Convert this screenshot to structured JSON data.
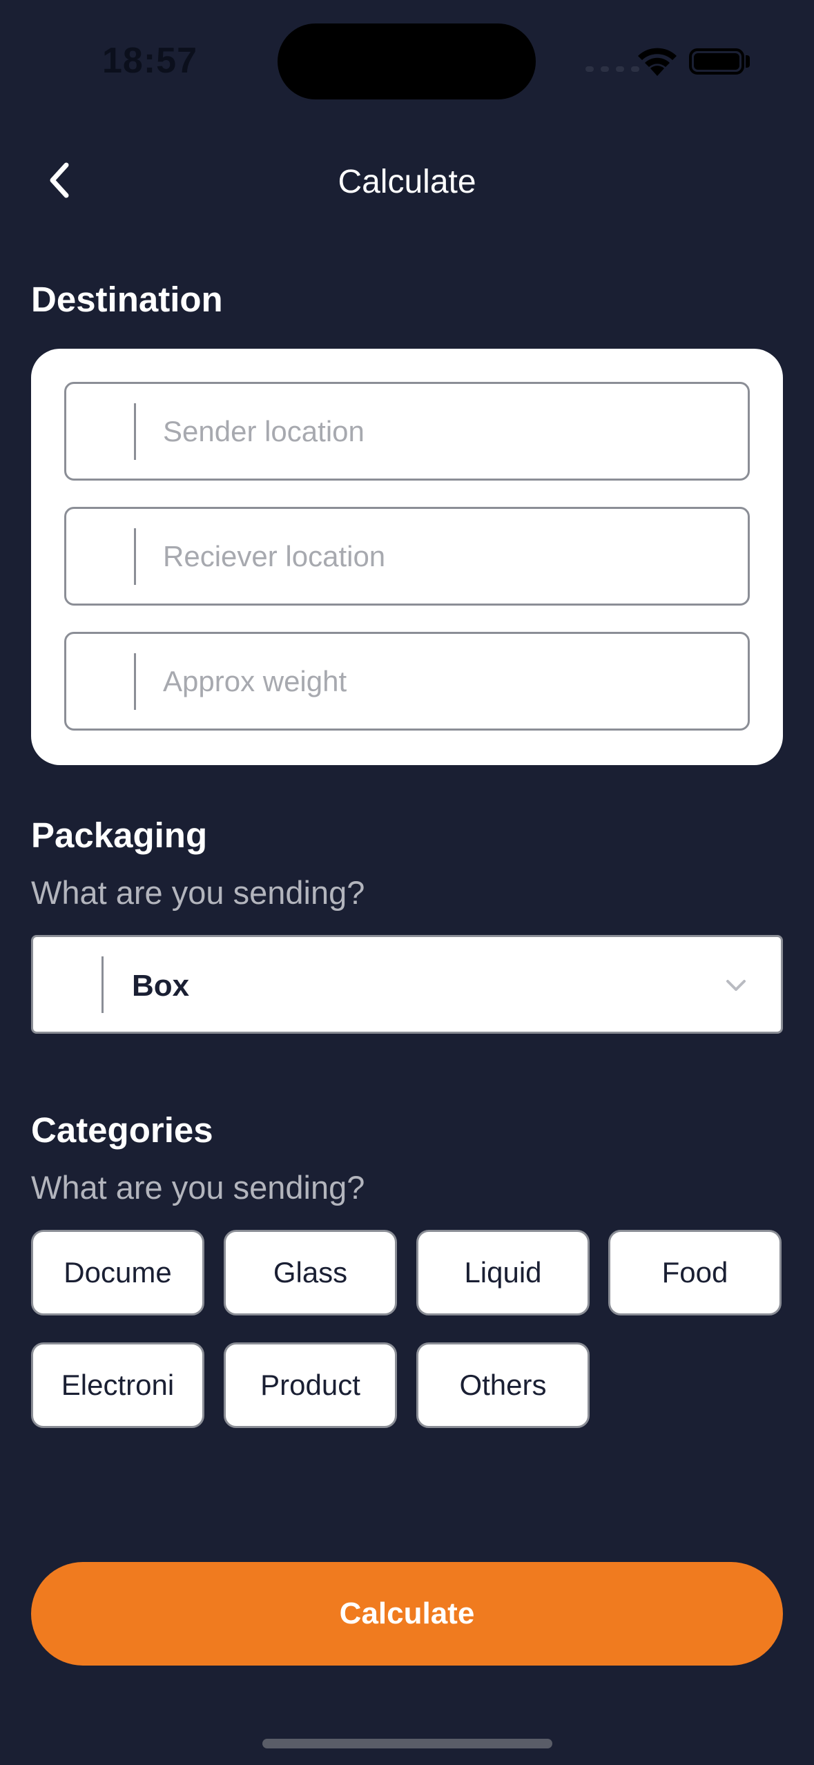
{
  "status_bar": {
    "time": "18:57"
  },
  "header": {
    "title": "Calculate"
  },
  "destination": {
    "heading": "Destination",
    "fields": [
      {
        "placeholder": "Sender location",
        "value": ""
      },
      {
        "placeholder": "Reciever location",
        "value": ""
      },
      {
        "placeholder": "Approx weight",
        "value": ""
      }
    ]
  },
  "packaging": {
    "heading": "Packaging",
    "subtitle": "What are you sending?",
    "selected": "Box",
    "icon": "chevron-down-icon"
  },
  "categories": {
    "heading": "Categories",
    "subtitle": "What are you sending?",
    "items": [
      "Docume",
      "Glass",
      "Liquid",
      "Food",
      "Electroni",
      "Product",
      "Others"
    ]
  },
  "calculate_button": {
    "label": "Calculate",
    "color": "#f07b1f"
  },
  "colors": {
    "background": "#1a1f33",
    "card": "#ffffff",
    "border": "#8b8e96"
  }
}
